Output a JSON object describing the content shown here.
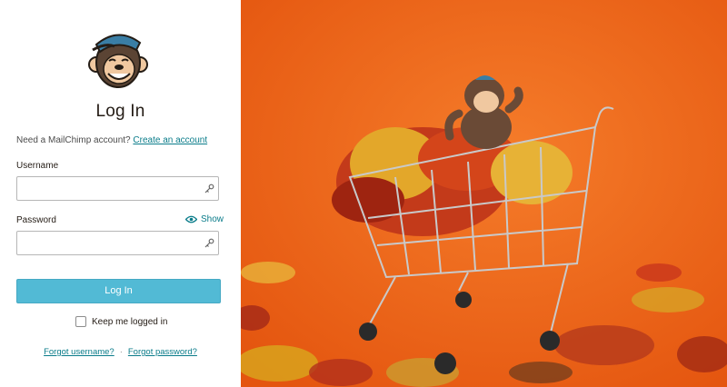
{
  "login": {
    "title": "Log In",
    "need_account_text": "Need a MailChimp account?",
    "create_account_link": "Create an account",
    "username_label": "Username",
    "username_value": "",
    "password_label": "Password",
    "password_value": "",
    "show_label": "Show",
    "submit_label": "Log In",
    "keep_logged_in_label": "Keep me logged in",
    "keep_logged_in_checked": false,
    "forgot_username": "Forgot username?",
    "separator": "·",
    "forgot_password": "Forgot password?"
  },
  "colors": {
    "button": "#52bad5",
    "link": "#0a7c8a",
    "photo_background": "#f26a1b"
  }
}
